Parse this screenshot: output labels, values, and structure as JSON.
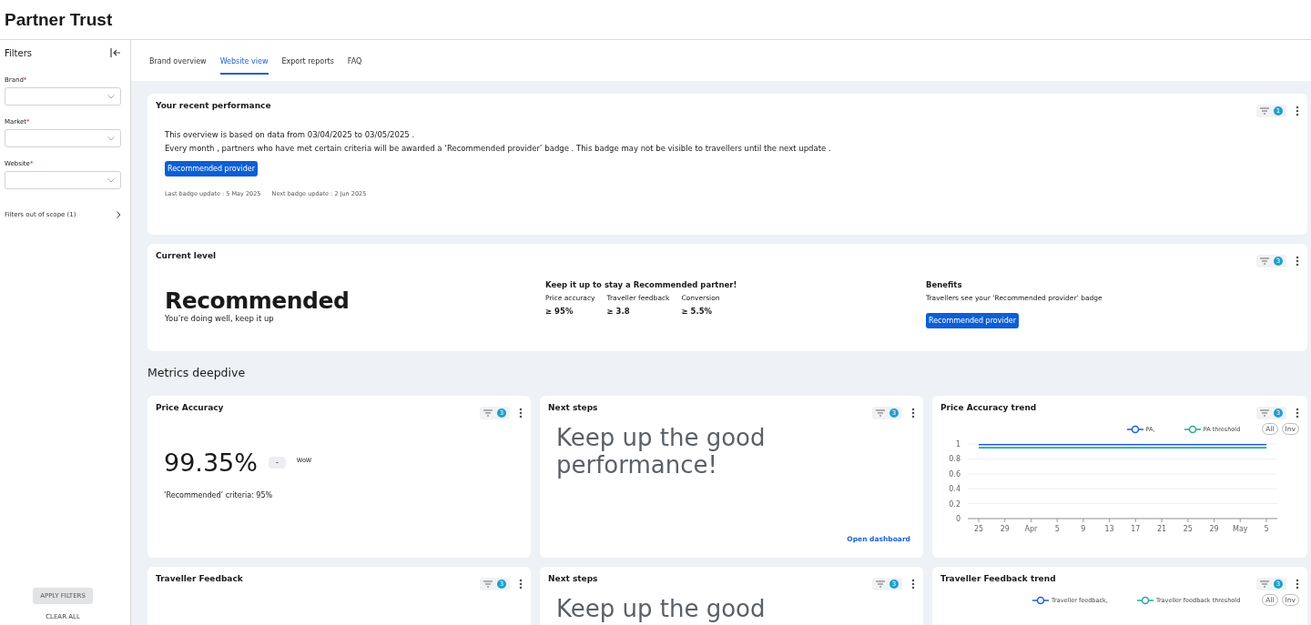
{
  "header": {
    "title": "Partner Trust"
  },
  "sidebar": {
    "title": "Filters",
    "fields": [
      {
        "label": "Brand",
        "required_mark": "*"
      },
      {
        "label": "Market",
        "required_mark": "*"
      },
      {
        "label": "Website",
        "required_mark": "*"
      }
    ],
    "out_of_scope": "Filters out of scope (1)",
    "apply": "APPLY FILTERS",
    "clear": "CLEAR ALL"
  },
  "tabs": [
    {
      "label": "Brand overview",
      "selected": false
    },
    {
      "label": "Website view",
      "selected": true
    },
    {
      "label": "Export reports",
      "selected": false
    },
    {
      "label": "FAQ",
      "selected": false
    }
  ],
  "performance": {
    "title": "Your recent performance",
    "filter_count": "1",
    "lines": [
      "This overview is based on data from 03/04/2025 to 03/05/2025 .",
      "Every month ,  partners who have met certain criteria will be awarded a ‘Recommended provider’ badge .  This badge may not be visible to travellers until the next update ."
    ],
    "badge": "Recommended provider",
    "updates": [
      "Last badge update :  5 May 2025",
      "Next badge update :  2 Jun 2025"
    ]
  },
  "current_level": {
    "title": "Current level",
    "filter_count": "3",
    "level": "Recommended",
    "subtitle": "You’re doing well, keep it up",
    "keep_title": "Keep it up to stay a Recommended partner!",
    "criteria": [
      {
        "label": "Price accuracy",
        "value": "≥ 95%"
      },
      {
        "label": "Traveller feedback",
        "value": "≥ 3.8"
      },
      {
        "label": "Conversion",
        "value": "≥ 5.5%"
      }
    ],
    "benefits_title": "Benefits",
    "benefits_text": "Travellers see your ‘Recommended provider’ badge",
    "badge": "Recommended provider"
  },
  "section_title": "Metrics deepdive",
  "cards": [
    {
      "kind": "metric",
      "title": "Price Accuracy",
      "filter_count": "3",
      "value": "99.35%",
      "change": "-",
      "change_label": "WoW",
      "criteria": "‘Recommended’ criteria: 95%"
    },
    {
      "kind": "next_steps",
      "title": "Next steps",
      "filter_count": "3",
      "message": "Keep up the good performance!",
      "link": "Open dashboard"
    },
    {
      "kind": "trend",
      "title": "Price Accuracy trend",
      "filter_count": "3",
      "toggles": [
        "All",
        "Inv"
      ],
      "chart_data": {
        "type": "line",
        "grid": true,
        "x": [
          "25",
          "29",
          "Apr",
          "5",
          "9",
          "13",
          "17",
          "21",
          "25",
          "29",
          "May",
          "5"
        ],
        "ylim": [
          0,
          1
        ],
        "yticks": [
          0,
          0.2,
          0.4,
          0.6,
          0.8,
          1
        ],
        "series": [
          {
            "name": "PA,",
            "color": "#1f5fd6",
            "values": [
              0.99,
              0.99,
              0.99,
              0.99,
              0.99,
              0.99,
              0.99,
              0.99,
              0.99,
              0.99,
              0.99,
              0.99
            ]
          },
          {
            "name": "PA threshold",
            "color": "#25a5a0",
            "values": [
              0.95,
              0.95,
              0.95,
              0.95,
              0.95,
              0.95,
              0.95,
              0.95,
              0.95,
              0.95,
              0.95,
              0.95
            ]
          }
        ]
      }
    },
    {
      "kind": "metric",
      "title": "Traveller Feedback",
      "filter_count": "3"
    },
    {
      "kind": "next_steps",
      "title": "Next steps",
      "filter_count": "3",
      "message": "Keep up the good"
    },
    {
      "kind": "trend",
      "title": "Traveller Feedback trend",
      "filter_count": "3",
      "toggles": [
        "All",
        "Inv"
      ],
      "legend": [
        {
          "name": "Traveller feedback,",
          "color": "#1f5fd6"
        },
        {
          "name": "Traveller feedback threshold",
          "color": "#25a5a0"
        }
      ]
    }
  ]
}
